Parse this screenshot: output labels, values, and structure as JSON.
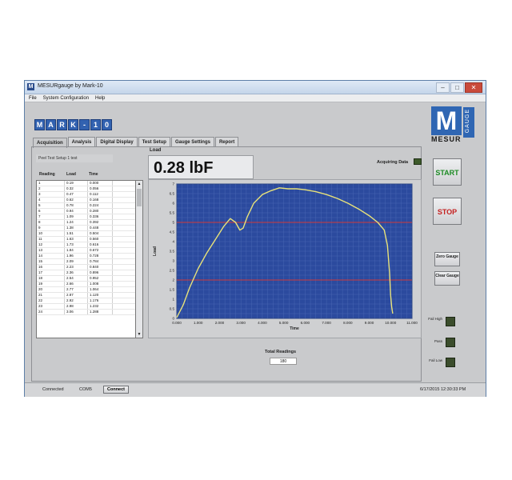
{
  "window": {
    "title": "MESURgauge by Mark-10"
  },
  "menu": [
    "File",
    "System Configuration",
    "Help"
  ],
  "branding": {
    "logo_letters": [
      "M",
      "A",
      "R",
      "K",
      "-",
      "1",
      "0"
    ],
    "mesur_mark": "M",
    "mesur_word": "MESUR",
    "gauge_word": "GAUGE"
  },
  "tabs": [
    "Acquisition",
    "Analysis",
    "Digital Display",
    "Test Setup",
    "Gauge Settings",
    "Report"
  ],
  "setup_name": "Peel Test Setup 1 test",
  "table": {
    "headers": [
      "Reading",
      "Load",
      "Time"
    ],
    "rows": [
      [
        "1",
        "0.19",
        "0.000"
      ],
      [
        "2",
        "0.32",
        "0.056"
      ],
      [
        "3",
        "0.47",
        "0.112"
      ],
      [
        "4",
        "0.62",
        "0.168"
      ],
      [
        "5",
        "0.78",
        "0.224"
      ],
      [
        "6",
        "0.94",
        "0.280"
      ],
      [
        "7",
        "1.09",
        "0.336"
      ],
      [
        "8",
        "1.24",
        "0.392"
      ],
      [
        "9",
        "1.38",
        "0.448"
      ],
      [
        "10",
        "1.51",
        "0.504"
      ],
      [
        "11",
        "1.63",
        "0.560"
      ],
      [
        "12",
        "1.73",
        "0.616"
      ],
      [
        "13",
        "1.84",
        "0.672"
      ],
      [
        "14",
        "1.96",
        "0.728"
      ],
      [
        "15",
        "2.09",
        "0.784"
      ],
      [
        "16",
        "2.23",
        "0.840"
      ],
      [
        "17",
        "2.36",
        "0.896"
      ],
      [
        "18",
        "2.54",
        "0.952"
      ],
      [
        "19",
        "2.66",
        "1.008"
      ],
      [
        "20",
        "2.77",
        "1.064"
      ],
      [
        "21",
        "2.87",
        "1.120"
      ],
      [
        "22",
        "2.92",
        "1.176"
      ],
      [
        "23",
        "2.98",
        "1.232"
      ],
      [
        "24",
        "3.06",
        "1.288"
      ]
    ]
  },
  "load": {
    "label": "Load",
    "value": "0.28 lbF"
  },
  "acquiring": {
    "label": "Acquiring Data"
  },
  "chart_data": {
    "type": "line",
    "xlabel": "Time",
    "ylabel": "Load",
    "xlim": [
      0,
      11
    ],
    "ylim": [
      0,
      7
    ],
    "xticks": [
      "0.000",
      "1.000",
      "2.000",
      "3.000",
      "4.000",
      "5.000",
      "6.000",
      "7.000",
      "8.000",
      "9.000",
      "10.000",
      "11.000"
    ],
    "yticks": [
      "0",
      "0.5",
      "1",
      "1.5",
      "2",
      "2.5",
      "3",
      "3.5",
      "4",
      "4.5",
      "5",
      "5.5",
      "6",
      "6.5",
      "7"
    ],
    "limit_lines": [
      2,
      5
    ],
    "background": "#2b4a9e",
    "line_color": "#e8e27a",
    "limit_color": "#d03a3a",
    "series": [
      {
        "x": [
          0,
          0.3,
          0.6,
          1.0,
          1.4,
          1.8,
          2.2,
          2.5,
          2.75,
          2.95,
          3.1,
          3.3,
          3.6,
          4.0,
          4.4,
          4.8,
          5.2,
          5.6,
          6.0,
          6.5,
          7.0,
          7.5,
          8.0,
          8.5,
          9.0,
          9.4,
          9.7,
          9.85,
          9.95,
          10.0,
          10.05,
          10.1
        ],
        "y": [
          0.05,
          0.7,
          1.6,
          2.6,
          3.4,
          4.1,
          4.8,
          5.2,
          5.0,
          4.6,
          4.7,
          5.3,
          6.0,
          6.45,
          6.65,
          6.8,
          6.75,
          6.75,
          6.7,
          6.6,
          6.45,
          6.25,
          6.0,
          5.7,
          5.35,
          5.0,
          4.6,
          3.8,
          2.4,
          1.2,
          0.6,
          0.25
        ]
      }
    ]
  },
  "buttons": {
    "start": "START",
    "stop": "STOP",
    "zero": "Zero Gauge",
    "clear": "Clear Gauge"
  },
  "indicators": [
    {
      "label": "Fail High"
    },
    {
      "label": "Pass"
    },
    {
      "label": "Fail Low"
    }
  ],
  "total": {
    "label": "Total Readings",
    "value": "180"
  },
  "status": {
    "connected": "Connected",
    "port": "COM5",
    "connect_button": "Connect",
    "datetime": "6/17/2015 12:30:33 PM"
  }
}
